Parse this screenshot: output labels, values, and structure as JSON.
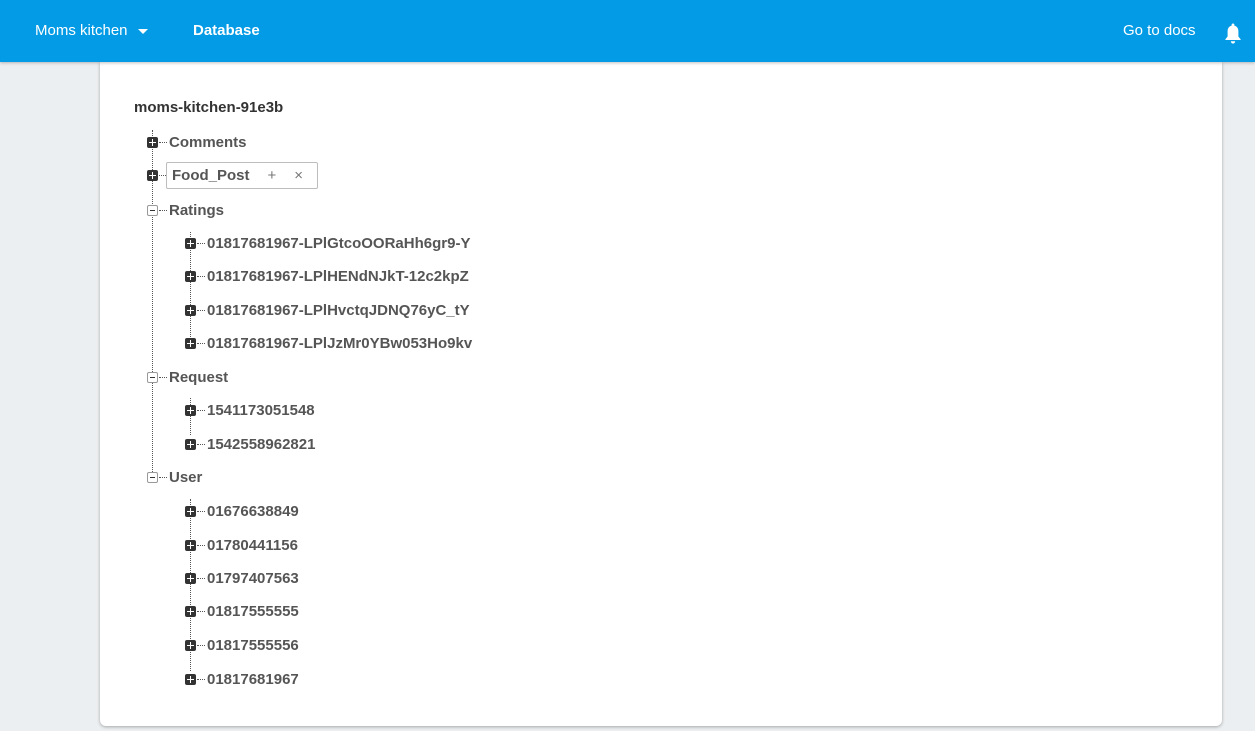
{
  "header": {
    "project_name": "Moms kitchen",
    "page_title": "Database",
    "docs_link": "Go to docs",
    "icons": [
      "chevron-down-icon",
      "bell-icon"
    ],
    "accent_color": "#039be5"
  },
  "tree": {
    "root": "moms-kitchen-91e3b",
    "nodes": [
      {
        "label": "Comments",
        "state": "collapsed"
      },
      {
        "label": "Food_Post",
        "state": "collapsed",
        "selected": true,
        "add_symbol": "+",
        "remove_symbol": "×"
      },
      {
        "label": "Ratings",
        "state": "expanded",
        "children": [
          "01817681967-LPlGtcoOORaHh6gr9-Y",
          "01817681967-LPlHENdNJkT-12c2kpZ",
          "01817681967-LPlHvctqJDNQ76yC_tY",
          "01817681967-LPlJzMr0YBw053Ho9kv"
        ]
      },
      {
        "label": "Request",
        "state": "expanded",
        "children": [
          "1541173051548",
          "1542558962821"
        ]
      },
      {
        "label": "User",
        "state": "expanded",
        "children": [
          "01676638849",
          "01780441156",
          "01797407563",
          "01817555555",
          "01817555556",
          "01817681967"
        ]
      }
    ]
  }
}
